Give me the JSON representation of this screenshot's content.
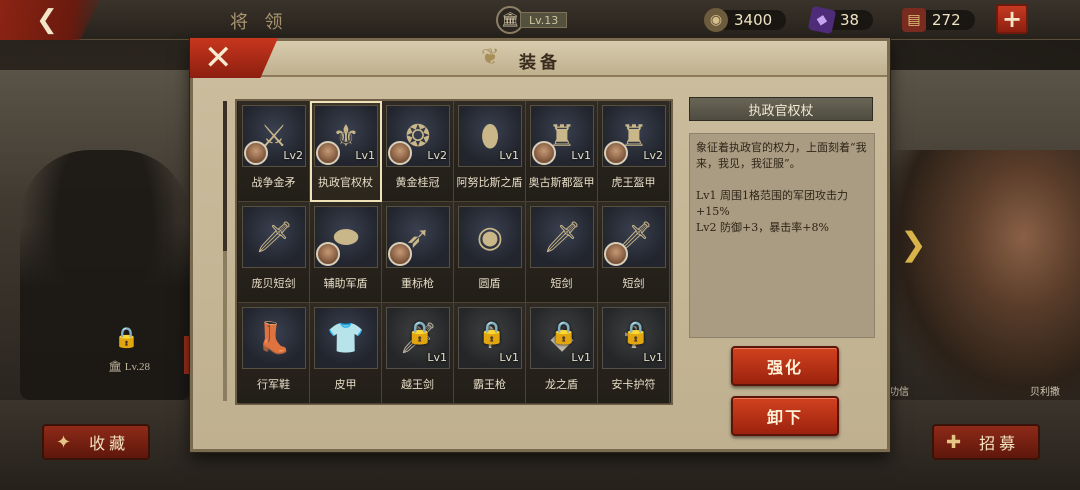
{
  "topbar": {
    "title": "将 领",
    "level": "Lv.13",
    "coins": "3400",
    "gems": "38",
    "scrolls": "272"
  },
  "background": {
    "locked_level": "Lv.28",
    "hero_tag": "功信",
    "hero_name": "贝利撒"
  },
  "bottom": {
    "collect_label": "收藏",
    "recruit_label": "招募"
  },
  "modal": {
    "title": "装备",
    "items": [
      {
        "name": "战争金矛",
        "level": "Lv2",
        "icon": "spear-icon",
        "glyph": "⚔",
        "has_avatar": true,
        "locked": false
      },
      {
        "name": "执政官权杖",
        "level": "Lv1",
        "icon": "scepter-icon",
        "glyph": "⚜",
        "has_avatar": true,
        "locked": false
      },
      {
        "name": "黄金桂冠",
        "level": "Lv2",
        "icon": "laurel-crown-icon",
        "glyph": "❂",
        "has_avatar": true,
        "locked": false
      },
      {
        "name": "阿努比斯之盾",
        "level": "Lv1",
        "icon": "shield-icon",
        "glyph": "⬮",
        "has_avatar": false,
        "locked": false
      },
      {
        "name": "奥古斯都盔甲",
        "level": "Lv1",
        "icon": "armor-icon",
        "glyph": "♜",
        "has_avatar": true,
        "locked": false
      },
      {
        "name": "虎王盔甲",
        "level": "Lv2",
        "icon": "armor-icon",
        "glyph": "♜",
        "has_avatar": true,
        "locked": false
      },
      {
        "name": "庞贝短剑",
        "level": "",
        "icon": "sword-icon",
        "glyph": "🗡",
        "has_avatar": false,
        "locked": false
      },
      {
        "name": "辅助军盾",
        "level": "",
        "icon": "round-shield-icon",
        "glyph": "⬬",
        "has_avatar": true,
        "locked": false
      },
      {
        "name": "重标枪",
        "level": "",
        "icon": "javelin-icon",
        "glyph": "➶",
        "has_avatar": true,
        "locked": false
      },
      {
        "name": "圆盾",
        "level": "",
        "icon": "round-shield-icon",
        "glyph": "◉",
        "has_avatar": false,
        "locked": false
      },
      {
        "name": "短剑",
        "level": "",
        "icon": "sword-icon",
        "glyph": "🗡",
        "has_avatar": false,
        "locked": false
      },
      {
        "name": "短剑",
        "level": "",
        "icon": "sword-icon",
        "glyph": "🗡",
        "has_avatar": true,
        "locked": false
      },
      {
        "name": "行军鞋",
        "level": "",
        "icon": "boots-icon",
        "glyph": "👢",
        "has_avatar": false,
        "locked": false
      },
      {
        "name": "皮甲",
        "level": "",
        "icon": "leather-armor-icon",
        "glyph": "👕",
        "has_avatar": false,
        "locked": false
      },
      {
        "name": "越王剑",
        "level": "Lv1",
        "icon": "sword-icon",
        "glyph": "🗡",
        "has_avatar": false,
        "locked": true
      },
      {
        "name": "霸王枪",
        "level": "Lv1",
        "icon": "spear-icon",
        "glyph": "↟",
        "has_avatar": false,
        "locked": true
      },
      {
        "name": "龙之盾",
        "level": "Lv1",
        "icon": "shield-icon",
        "glyph": "◆",
        "has_avatar": false,
        "locked": true
      },
      {
        "name": "安卡护符",
        "level": "Lv1",
        "icon": "ankh-icon",
        "glyph": "☥",
        "has_avatar": false,
        "locked": true
      }
    ],
    "detail": {
      "title": "执政官权杖",
      "description": "象征着执政官的权力，上面刻着“我来，我见，我征服”。",
      "lv1": "Lv1  周围1格范围的军团攻击力+15%",
      "lv2": "Lv2  防御+3，暴击率+8%"
    },
    "upgrade_label": "强化",
    "unequip_label": "卸下"
  }
}
